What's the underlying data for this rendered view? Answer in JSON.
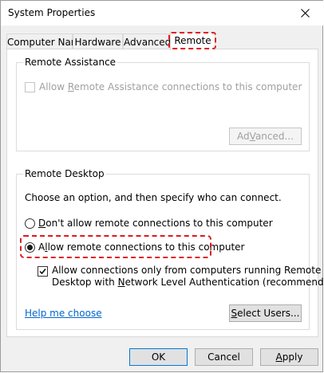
{
  "window": {
    "title": "System Properties"
  },
  "tabs": [
    {
      "label": "Computer Name"
    },
    {
      "label": "Hardware"
    },
    {
      "label": "Advanced"
    },
    {
      "label": "Remote"
    }
  ],
  "remote_assistance": {
    "group_title": "Remote Assistance",
    "checkbox_label_pre": "Allow ",
    "checkbox_label_accel": "R",
    "checkbox_label_post": "emote Assistance connections to this computer",
    "checked": false,
    "enabled": false,
    "advanced_label_accel": "V",
    "advanced_label_pre": "Ad",
    "advanced_label_post": "anced..."
  },
  "remote_desktop": {
    "group_title": "Remote Desktop",
    "instruction": "Choose an option, and then specify who can connect.",
    "option_deny_accel": "D",
    "option_deny_post": "on't allow remote connections to this computer",
    "option_deny_selected": false,
    "option_allow_pre": "A",
    "option_allow_accel": "l",
    "option_allow_post": "low remote connections to this computer",
    "option_allow_selected": true,
    "nla_line1": "Allow connections only from computers running Remote",
    "nla_line2_pre": "Desktop with ",
    "nla_line2_accel": "N",
    "nla_line2_post": "etwork Level Authentication (recommended)",
    "nla_checked": true,
    "help_link": "Help me choose",
    "select_users_pre": "",
    "select_users_accel": "S",
    "select_users_post": "elect Users..."
  },
  "footer": {
    "ok_label": "OK",
    "cancel_label": "Cancel",
    "apply_accel": "A",
    "apply_post": "pply"
  },
  "colors": {
    "highlight": "#e0181f",
    "link": "#0066cc",
    "default_button_border": "#0078d7"
  }
}
